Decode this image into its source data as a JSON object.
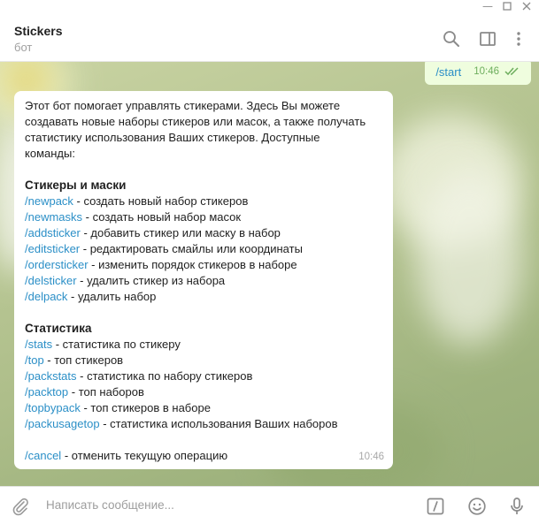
{
  "window": {
    "controls": [
      "minimize",
      "maximize",
      "close"
    ]
  },
  "header": {
    "title": "Stickers",
    "status": "бот",
    "icons": [
      "search-icon",
      "sidebar-toggle-icon",
      "more-vert-icon"
    ]
  },
  "outgoing_message": {
    "text": "/start",
    "time": "10:46",
    "read_status": "double-check-icon",
    "bubble_color": "#effdde"
  },
  "incoming_message": {
    "intro_lines": [
      "Этот бот помогает управлять стикерами. Здесь Вы можете",
      "создавать новые наборы стикеров или масок, а также получать",
      "статистику использования Ваших стикеров. Доступные",
      "команды:"
    ],
    "section1_title": "Стикеры и маски",
    "section1_items": [
      {
        "cmd": "/newpack",
        "desc": " - создать новый набор стикеров"
      },
      {
        "cmd": "/newmasks",
        "desc": " - создать новый набор масок"
      },
      {
        "cmd": "/addsticker",
        "desc": " - добавить стикер или маску в набор"
      },
      {
        "cmd": "/editsticker",
        "desc": " - редактировать смайлы или координаты"
      },
      {
        "cmd": "/ordersticker",
        "desc": " - изменить порядок стикеров в наборе"
      },
      {
        "cmd": "/delsticker",
        "desc": " -  удалить стикер из набора"
      },
      {
        "cmd": "/delpack",
        "desc": " - удалить набор"
      }
    ],
    "section2_title": "Статистика",
    "section2_items": [
      {
        "cmd": "/stats",
        "desc": " - статистика по стикеру"
      },
      {
        "cmd": "/top",
        "desc": " - топ стикеров"
      },
      {
        "cmd": "/packstats",
        "desc": " - статистика по набору стикеров"
      },
      {
        "cmd": "/packtop",
        "desc": " - топ наборов"
      },
      {
        "cmd": "/topbypack",
        "desc": " - топ стикеров в наборе"
      },
      {
        "cmd": "/packusagetop",
        "desc": " - статистика использования Ваших наборов"
      }
    ],
    "cancel_item": {
      "cmd": "/cancel",
      "desc": " - отменить текущую операцию"
    },
    "time": "10:46"
  },
  "composer": {
    "placeholder": "Написать сообщение...",
    "value": "",
    "icons": [
      "attach-icon",
      "bot-commands-icon",
      "emoji-icon",
      "microphone-icon"
    ]
  },
  "colors": {
    "link": "#2b8fc7",
    "read_check": "#6dae5d",
    "background": "#b9c795"
  }
}
